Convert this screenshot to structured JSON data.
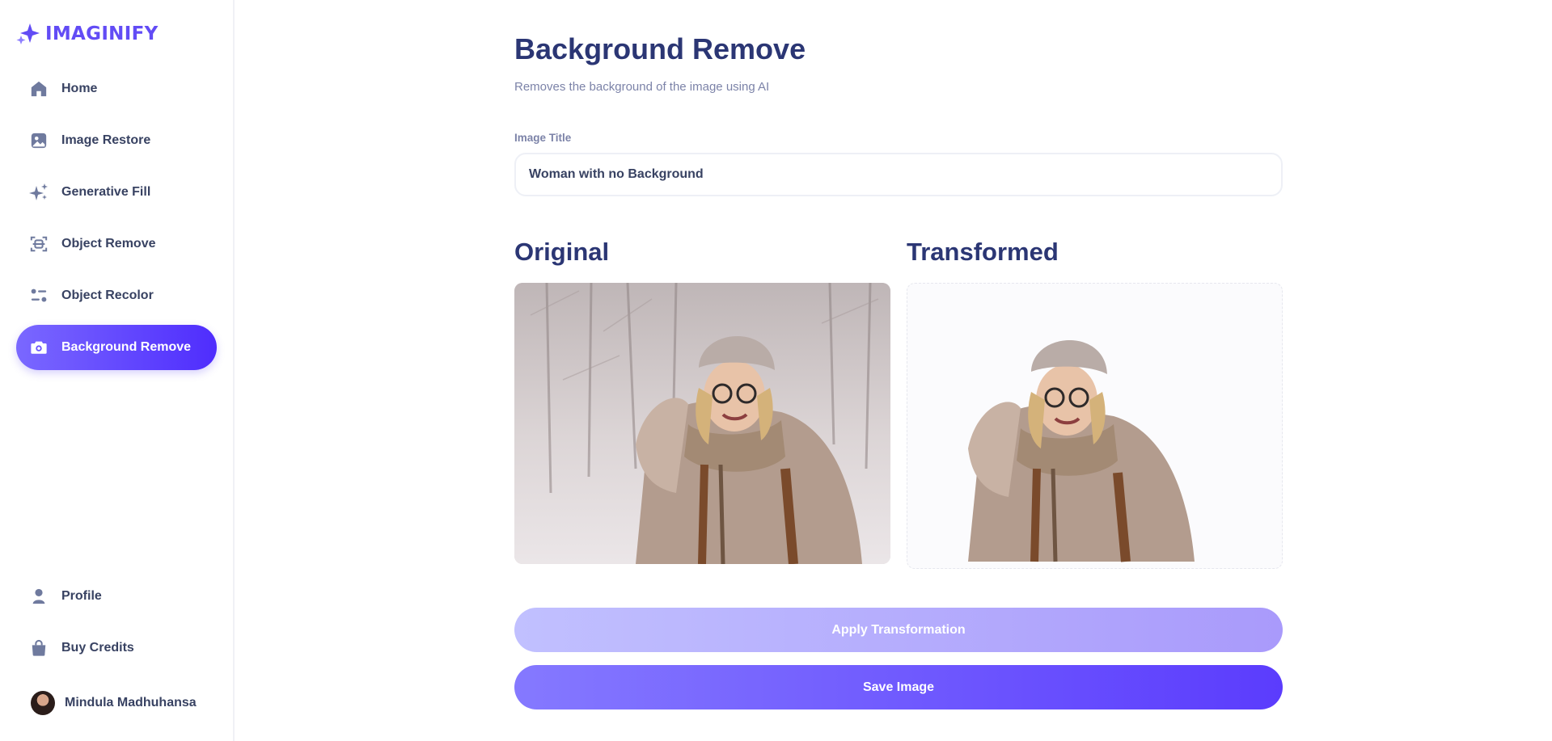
{
  "brand": {
    "name": "IMAGINIFY",
    "icon": "sparkle-logo-icon",
    "color": "#624cf5"
  },
  "sidebar": {
    "items": [
      {
        "label": "Home",
        "icon": "home-icon"
      },
      {
        "label": "Image Restore",
        "icon": "image-icon"
      },
      {
        "label": "Generative Fill",
        "icon": "stars-icon"
      },
      {
        "label": "Object Remove",
        "icon": "scan-icon"
      },
      {
        "label": "Object Recolor",
        "icon": "filter-icon"
      },
      {
        "label": "Background Remove",
        "icon": "camera-icon",
        "active": true
      }
    ],
    "bottom_items": [
      {
        "label": "Profile",
        "icon": "user-icon"
      },
      {
        "label": "Buy Credits",
        "icon": "bag-icon"
      }
    ],
    "user": {
      "name": "Mindula Madhuhansa",
      "avatar": "avatar-photo"
    }
  },
  "main": {
    "title": "Background Remove",
    "subtitle": "Removes the background of the image using AI",
    "form": {
      "title_label": "Image Title",
      "title_value": "Woman with no Background"
    },
    "original_heading": "Original",
    "transformed_heading": "Transformed",
    "apply_button": "Apply Transformation",
    "save_button": "Save Image"
  },
  "colors": {
    "accent": "#624cf5",
    "active_gradient_start": "#7a68ff",
    "active_gradient_end": "#4f2dfd",
    "heading": "#2b3674",
    "muted": "#7c83a8",
    "apply_disabled": "#b7b0fd"
  }
}
